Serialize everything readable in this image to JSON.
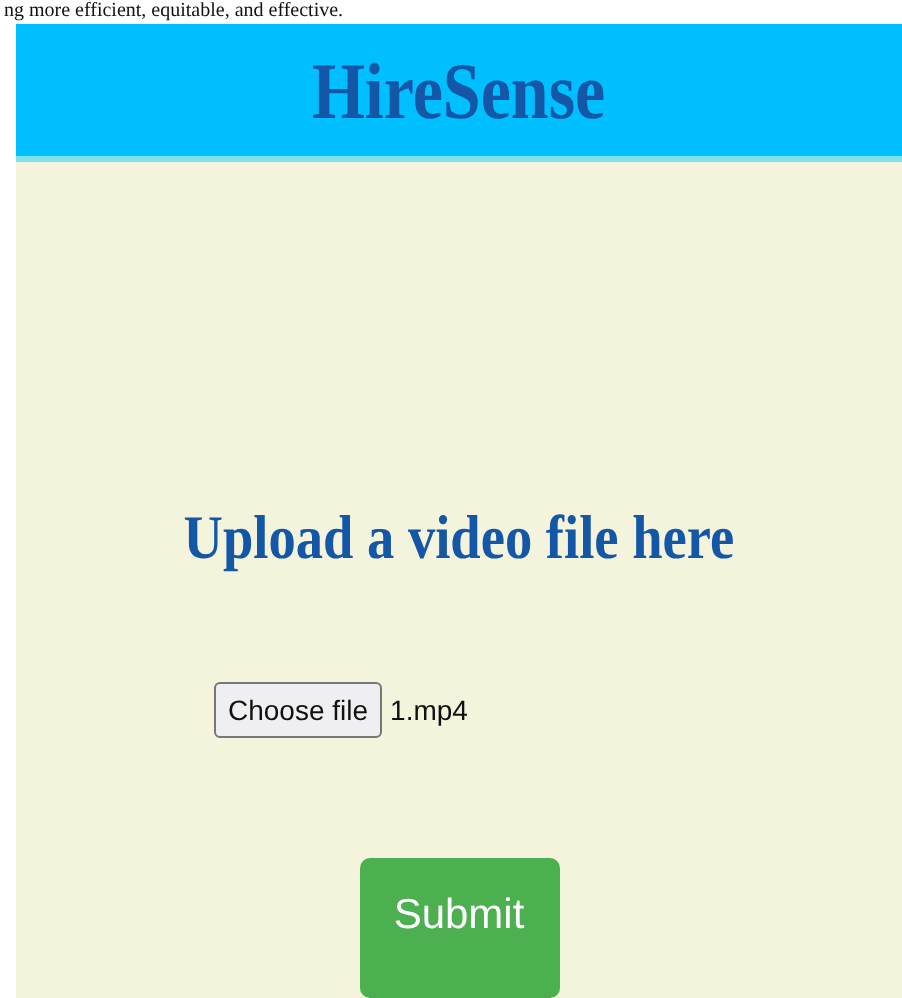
{
  "top_text": "ng more efficient, equitable, and effective.",
  "header": {
    "title": "HireSense"
  },
  "upload": {
    "heading": "Upload a video file here",
    "choose_button": "Choose file",
    "file_name": "1.mp4",
    "submit_button": "Submit"
  }
}
